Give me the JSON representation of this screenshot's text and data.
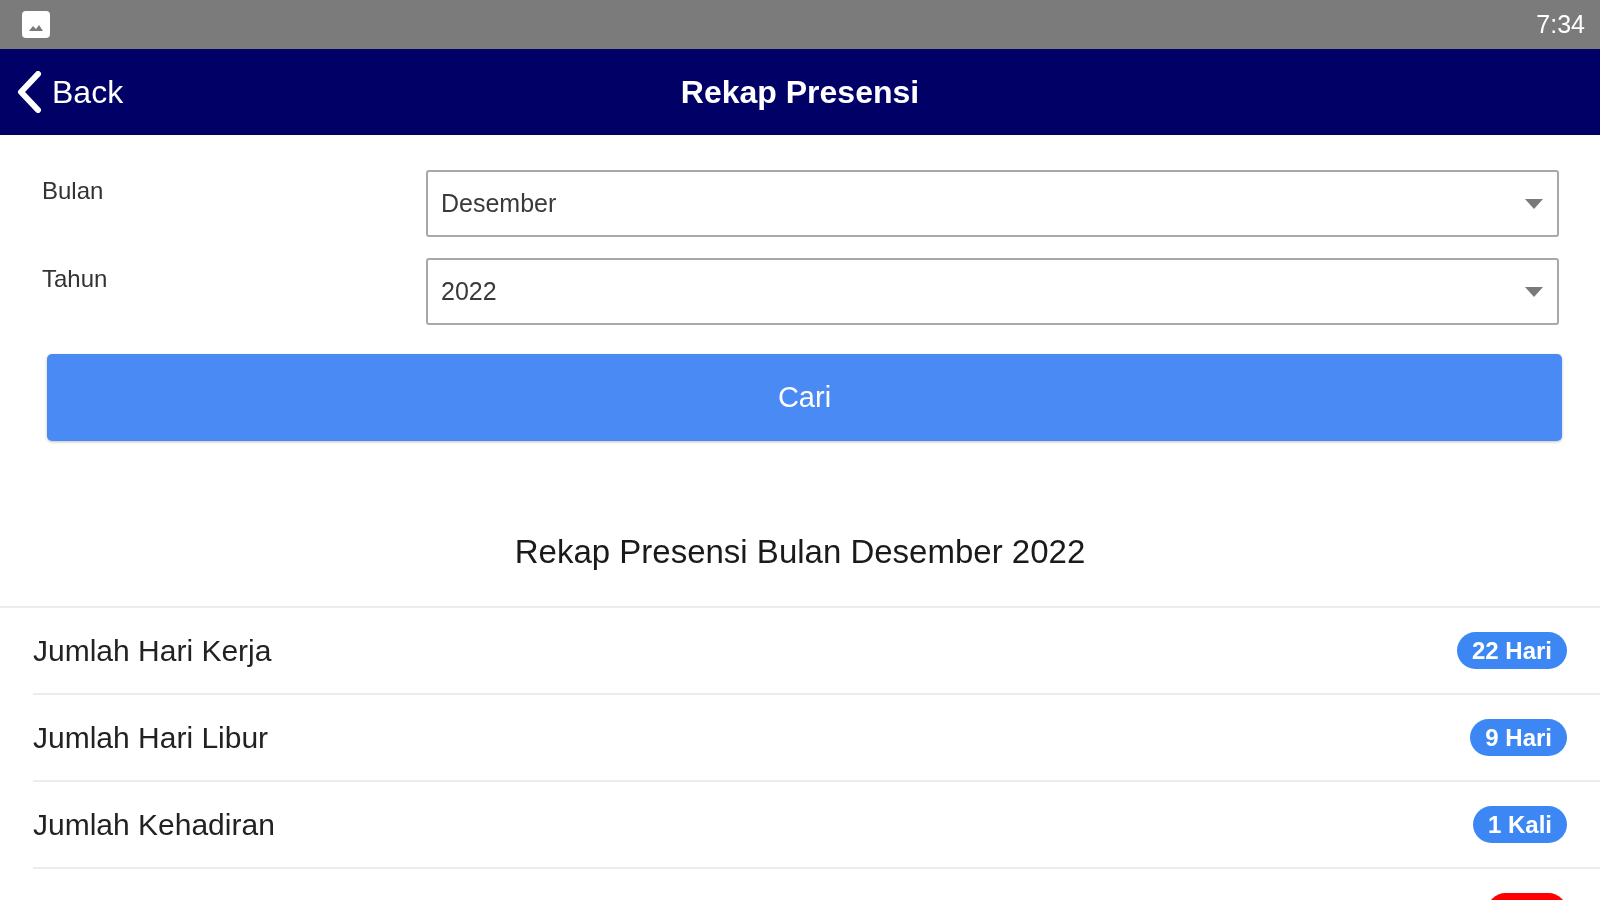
{
  "status_bar": {
    "time": "7:34"
  },
  "app_bar": {
    "back_label": "Back",
    "title": "Rekap Presensi"
  },
  "filters": [
    {
      "label": "Bulan",
      "value": "Desember"
    },
    {
      "label": "Tahun",
      "value": "2022"
    }
  ],
  "search_button": "Cari",
  "summary": {
    "heading": "Rekap Presensi Bulan Desember 2022",
    "rows": [
      {
        "label": "Jumlah Hari Kerja",
        "badge": "22 Hari",
        "color": "#3d87f5"
      },
      {
        "label": "Jumlah Hari Libur",
        "badge": "9 Hari",
        "color": "#3d87f5"
      },
      {
        "label": "Jumlah Kehadiran",
        "badge": "1 Kali",
        "color": "#3d87f5"
      },
      {
        "color": "#ff0000"
      }
    ]
  }
}
